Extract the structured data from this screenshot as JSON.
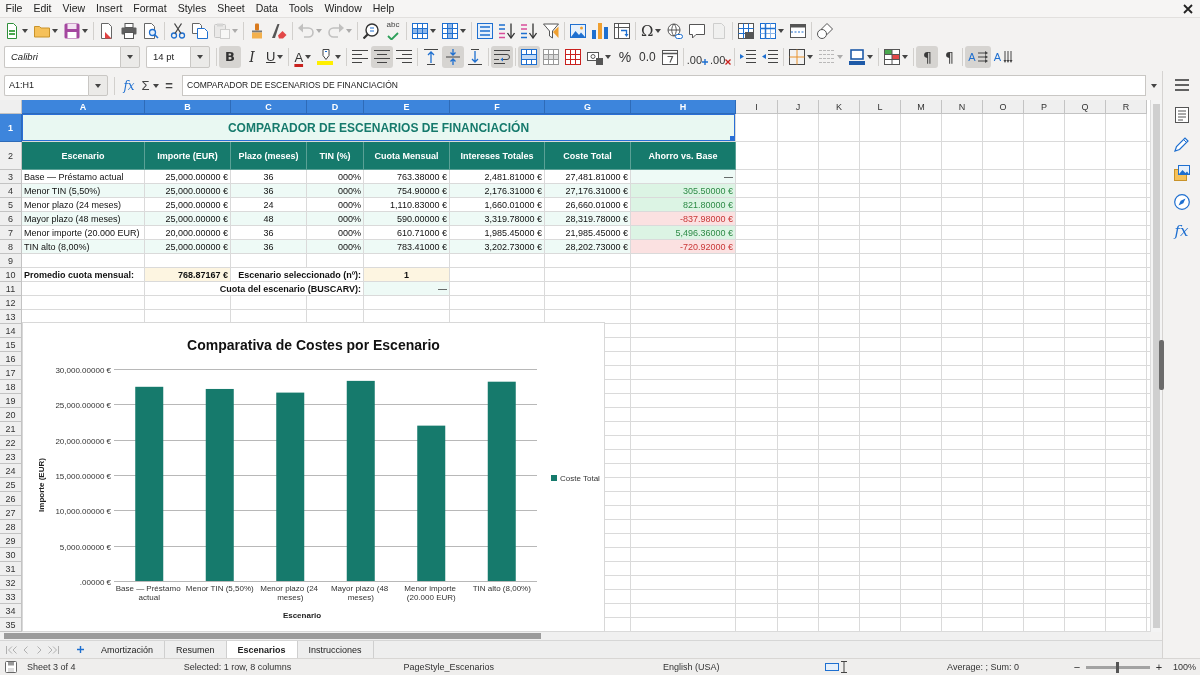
{
  "menu_bar": {
    "items": [
      "File",
      "Edit",
      "View",
      "Insert",
      "Format",
      "Styles",
      "Sheet",
      "Data",
      "Tools",
      "Window",
      "Help"
    ]
  },
  "toolbar_standard": {
    "groups": [
      [
        {
          "kind": "new",
          "menu": true,
          "disabled": false
        },
        {
          "kind": "open",
          "menu": true,
          "disabled": false
        },
        {
          "kind": "save",
          "menu": true,
          "disabled": false
        }
      ],
      [
        {
          "kind": "export-pdf",
          "disabled": false
        },
        {
          "kind": "print",
          "disabled": false
        },
        {
          "kind": "print-preview",
          "disabled": false
        }
      ],
      [
        {
          "kind": "cut",
          "disabled": false
        },
        {
          "kind": "copy",
          "disabled": false
        },
        {
          "kind": "paste",
          "menu": true,
          "disabled": true
        }
      ],
      [
        {
          "kind": "clone",
          "disabled": false
        },
        {
          "kind": "clear-format",
          "disabled": false
        }
      ],
      [
        {
          "kind": "undo",
          "menu": true,
          "disabled": true
        },
        {
          "kind": "redo",
          "menu": true,
          "disabled": true
        }
      ],
      [
        {
          "kind": "find",
          "disabled": false
        },
        {
          "kind": "spelling",
          "label": "abc",
          "disabled": false
        }
      ],
      [
        {
          "kind": "rows",
          "menu": true,
          "disabled": false
        },
        {
          "kind": "columns",
          "menu": true,
          "disabled": false
        }
      ],
      [
        {
          "kind": "sort",
          "disabled": false
        },
        {
          "kind": "sort-asc",
          "disabled": false
        },
        {
          "kind": "sort-desc",
          "disabled": false
        },
        {
          "kind": "filter",
          "disabled": false
        }
      ],
      [
        {
          "kind": "image",
          "disabled": false
        },
        {
          "kind": "chart",
          "disabled": false
        },
        {
          "kind": "pivot",
          "disabled": false
        }
      ],
      [
        {
          "kind": "special-char",
          "label": "Ω",
          "menu": true,
          "disabled": false
        },
        {
          "kind": "hyperlink",
          "disabled": false
        },
        {
          "kind": "comment",
          "disabled": false
        },
        {
          "kind": "header-footer",
          "disabled": true
        }
      ],
      [
        {
          "kind": "print-area",
          "disabled": false
        },
        {
          "kind": "freeze",
          "menu": true,
          "disabled": false
        },
        {
          "kind": "split",
          "disabled": false
        }
      ],
      [
        {
          "kind": "shapes",
          "disabled": false
        }
      ]
    ]
  },
  "toolbar_formatting": {
    "font_name": "Calibri",
    "font_size": "14 pt",
    "groups": [
      [
        {
          "kind": "bold",
          "label": "B",
          "pressed": true,
          "disabled": false
        },
        {
          "kind": "italic",
          "label": "I",
          "pressed": false,
          "disabled": false
        },
        {
          "kind": "underline",
          "label": "U",
          "menu": true,
          "pressed": false,
          "disabled": false
        }
      ],
      [
        {
          "kind": "font-color",
          "label": "A",
          "menu": true,
          "pressed": false,
          "disabled": false
        },
        {
          "kind": "highlight",
          "menu": true,
          "pressed": false,
          "disabled": false
        }
      ],
      [
        {
          "kind": "align-left",
          "pressed": false,
          "disabled": false
        },
        {
          "kind": "align-center",
          "pressed": true,
          "disabled": false
        },
        {
          "kind": "align-right",
          "pressed": false,
          "disabled": false
        }
      ],
      [
        {
          "kind": "align-top",
          "pressed": false,
          "disabled": false
        },
        {
          "kind": "align-middle",
          "pressed": true,
          "disabled": false
        },
        {
          "kind": "align-bottom",
          "pressed": false,
          "disabled": false
        }
      ],
      [
        {
          "kind": "wrap",
          "pressed": true,
          "disabled": false
        }
      ],
      [
        {
          "kind": "merge-center",
          "pressed": true,
          "disabled": false
        },
        {
          "kind": "merge",
          "pressed": false,
          "disabled": false
        },
        {
          "kind": "unmerge",
          "pressed": false,
          "disabled": false
        },
        {
          "kind": "currency",
          "menu": true,
          "pressed": false,
          "disabled": false
        },
        {
          "kind": "percent",
          "label": "%",
          "pressed": false,
          "disabled": false
        },
        {
          "kind": "number",
          "label": "0.0",
          "pressed": false,
          "disabled": false
        },
        {
          "kind": "date",
          "pressed": false,
          "disabled": false
        }
      ],
      [
        {
          "kind": "add-decimal",
          "label": ".00",
          "pressed": false,
          "disabled": false
        },
        {
          "kind": "del-decimal",
          "label": ".00",
          "pressed": false,
          "disabled": false
        }
      ],
      [
        {
          "kind": "indent-more",
          "pressed": false,
          "disabled": false
        },
        {
          "kind": "indent-less",
          "pressed": false,
          "disabled": false
        }
      ],
      [
        {
          "kind": "borders",
          "menu": true,
          "pressed": false,
          "disabled": false
        },
        {
          "kind": "border-style",
          "menu": true,
          "pressed": false,
          "disabled": true
        },
        {
          "kind": "border-color",
          "menu": true,
          "pressed": false,
          "disabled": false
        }
      ],
      [
        {
          "kind": "conditional",
          "menu": true,
          "pressed": false,
          "disabled": false
        }
      ],
      [
        {
          "kind": "ltr",
          "label": "¶",
          "pressed": true,
          "disabled": false
        },
        {
          "kind": "rtl",
          "label": "¶",
          "pressed": false,
          "disabled": false
        }
      ],
      [
        {
          "kind": "text-ltr",
          "label": "A",
          "pressed": true,
          "disabled": false
        },
        {
          "kind": "text-ttb",
          "label": "A",
          "pressed": false,
          "disabled": false
        }
      ]
    ]
  },
  "formula_bar": {
    "name_box": "A1:H1",
    "function_wizard": "fx",
    "sum": "Σ",
    "equals": "=",
    "content": "COMPARADOR DE ESCENARIOS DE FINANCIACIÓN"
  },
  "sidebar": {
    "items": [
      {
        "kind": "properties"
      },
      {
        "kind": "styles"
      },
      {
        "kind": "gallery"
      },
      {
        "kind": "navigator"
      },
      {
        "kind": "functions",
        "label": "fx"
      }
    ]
  },
  "sheet": {
    "columns": [
      {
        "label": "A",
        "selected": true
      },
      {
        "label": "B",
        "selected": true
      },
      {
        "label": "C",
        "selected": true
      },
      {
        "label": "D",
        "selected": true
      },
      {
        "label": "E",
        "selected": true
      },
      {
        "label": "F",
        "selected": true
      },
      {
        "label": "G",
        "selected": true
      },
      {
        "label": "H",
        "selected": true
      },
      {
        "label": "I",
        "selected": false
      },
      {
        "label": "J",
        "selected": false
      },
      {
        "label": "K",
        "selected": false
      },
      {
        "label": "L",
        "selected": false
      },
      {
        "label": "M",
        "selected": false
      },
      {
        "label": "N",
        "selected": false
      },
      {
        "label": "O",
        "selected": false
      },
      {
        "label": "P",
        "selected": false
      },
      {
        "label": "Q",
        "selected": false
      },
      {
        "label": "R",
        "selected": false
      }
    ],
    "rows": [
      {
        "label": "1",
        "selected": true
      },
      {
        "label": "2",
        "selected": false
      },
      {
        "label": "3",
        "selected": false
      },
      {
        "label": "4",
        "selected": false
      },
      {
        "label": "5",
        "selected": false
      },
      {
        "label": "6",
        "selected": false
      },
      {
        "label": "7",
        "selected": false
      },
      {
        "label": "8",
        "selected": false
      },
      {
        "label": "9",
        "selected": false
      },
      {
        "label": "10",
        "selected": false
      },
      {
        "label": "11",
        "selected": false
      },
      {
        "label": "12",
        "selected": false
      },
      {
        "label": "13",
        "selected": false
      },
      {
        "label": "14",
        "selected": false
      },
      {
        "label": "15",
        "selected": false
      },
      {
        "label": "16",
        "selected": false
      },
      {
        "label": "17",
        "selected": false
      },
      {
        "label": "18",
        "selected": false
      },
      {
        "label": "19",
        "selected": false
      },
      {
        "label": "20",
        "selected": false
      },
      {
        "label": "21",
        "selected": false
      },
      {
        "label": "22",
        "selected": false
      },
      {
        "label": "23",
        "selected": false
      },
      {
        "label": "24",
        "selected": false
      },
      {
        "label": "25",
        "selected": false
      },
      {
        "label": "26",
        "selected": false
      },
      {
        "label": "27",
        "selected": false
      },
      {
        "label": "28",
        "selected": false
      },
      {
        "label": "29",
        "selected": false
      },
      {
        "label": "30",
        "selected": false
      },
      {
        "label": "31",
        "selected": false
      },
      {
        "label": "32",
        "selected": false
      },
      {
        "label": "33",
        "selected": false
      },
      {
        "label": "34",
        "selected": false
      },
      {
        "label": "35",
        "selected": false
      }
    ],
    "title": {
      "text": "COMPARADOR DE ESCENARIOS DE FINANCIACIÓN",
      "selected": true
    },
    "table": {
      "columns": [
        "Escenario",
        "Importe (EUR)",
        "Plazo (meses)",
        "TIN (%)",
        "Cuota Mensual",
        "Intereses Totales",
        "Coste Total",
        "Ahorro vs. Base"
      ],
      "rows": [
        {
          "cells": [
            "Base — Préstamo actual",
            "25,000.00000 €",
            "36",
            "000%",
            "763.38000 €",
            "2,481.81000 €",
            "27,481.81000 €",
            "—"
          ],
          "shaded": false,
          "kind": "neutral"
        },
        {
          "cells": [
            "Menor TIN (5,50%)",
            "25,000.00000 €",
            "36",
            "000%",
            "754.90000 €",
            "2,176.31000 €",
            "27,176.31000 €",
            "305.50000 €"
          ],
          "shaded": true,
          "kind": "positive"
        },
        {
          "cells": [
            "Menor plazo (24 meses)",
            "25,000.00000 €",
            "24",
            "000%",
            "1,110.83000 €",
            "1,660.01000 €",
            "26,660.01000 €",
            "821.80000 €"
          ],
          "shaded": false,
          "kind": "positive"
        },
        {
          "cells": [
            "Mayor plazo (48 meses)",
            "25,000.00000 €",
            "48",
            "000%",
            "590.00000 €",
            "3,319.78000 €",
            "28,319.78000 €",
            "-837.98000 €"
          ],
          "shaded": true,
          "kind": "negative"
        },
        {
          "cells": [
            "Menor importe (20.000 EUR)",
            "20,000.00000 €",
            "36",
            "000%",
            "610.71000 €",
            "1,985.45000 €",
            "21,985.45000 €",
            "5,496.36000 €"
          ],
          "shaded": false,
          "kind": "positive"
        },
        {
          "cells": [
            "TIN alto (8,00%)",
            "25,000.00000 €",
            "36",
            "000%",
            "783.41000 €",
            "3,202.73000 €",
            "28,202.73000 €",
            "-720.92000 €"
          ],
          "shaded": true,
          "kind": "negative"
        }
      ]
    },
    "summary": {
      "average_label": "Promedio cuota mensual:",
      "average_value": "768.87167 €",
      "selected_label": "Escenario seleccionado (nº):",
      "selected_value": "1",
      "lookup_label": "Cuota del escenario (BUSCARV):",
      "lookup_value": "—"
    },
    "chart": {
      "chart_data": {
        "type": "bar",
        "title": "Comparativa de Costes por Escenario",
        "xlabel": "Escenario",
        "ylabel": "Importe (EUR)",
        "categories": [
          "Base — Préstamo actual",
          "Menor TIN (5,50%)",
          "Menor plazo (24 meses)",
          "Mayor plazo (48 meses)",
          "Menor importe (20.000 EUR)",
          "TIN alto (8,00%)"
        ],
        "series": [
          {
            "name": "Coste Total",
            "color": "#167a6c",
            "values": [
              27481.81,
              27176.31,
              26660.01,
              28319.78,
              21985.45,
              28202.73
            ]
          }
        ],
        "ylim": [
          0,
          30000
        ],
        "yticks": [
          {
            "value": 0,
            "label": ".00000 €"
          },
          {
            "value": 5000,
            "label": "5,000.00000 €"
          },
          {
            "value": 10000,
            "label": "10,000.00000 €"
          },
          {
            "value": 15000,
            "label": "15,000.00000 €"
          },
          {
            "value": 20000,
            "label": "20,000.00000 €"
          },
          {
            "value": 25000,
            "label": "25,000.00000 €"
          },
          {
            "value": 30000,
            "label": "30,000.00000 €"
          }
        ],
        "grid": true
      }
    }
  },
  "sheet_tabs": {
    "navigation": [
      {
        "kind": "first",
        "disabled": true
      },
      {
        "kind": "previous",
        "disabled": true
      },
      {
        "kind": "next",
        "disabled": true
      },
      {
        "kind": "last",
        "disabled": true
      }
    ],
    "tabs": [
      {
        "label": "Amortización",
        "selected": false
      },
      {
        "label": "Resumen",
        "selected": false
      },
      {
        "label": "Escenarios",
        "selected": true
      },
      {
        "label": "Instrucciones",
        "selected": false
      }
    ]
  },
  "status_bar": {
    "sheet": "Sheet 3 of 4",
    "selection": "Selected: 1 row, 8 columns",
    "page_style": "PageStyle_Escenarios",
    "language": "English (USA)",
    "sum": "Average: ; Sum: 0",
    "zoom_out": "−",
    "zoom_slider": {
      "level": 0.5
    },
    "zoom_in": "+",
    "zoom": "100%"
  }
}
